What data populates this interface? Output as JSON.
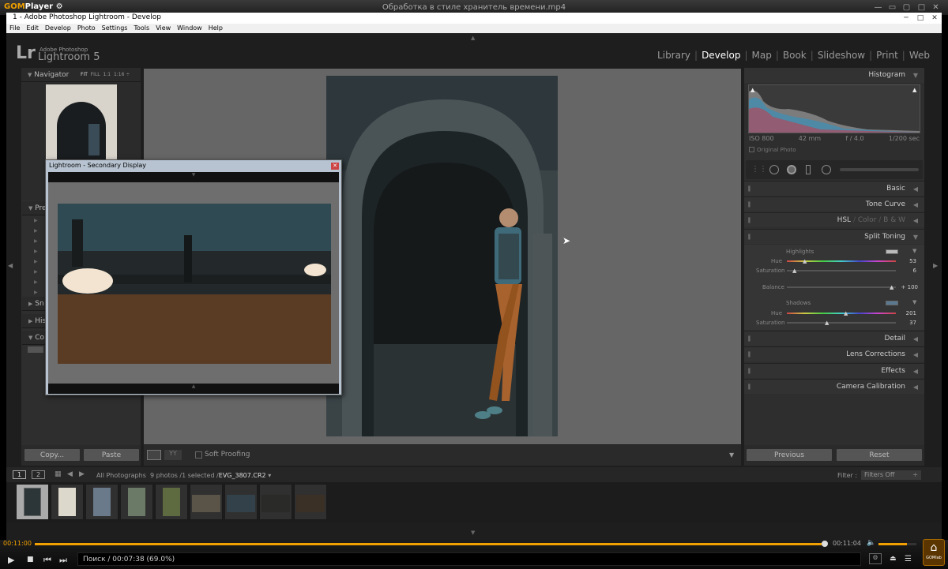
{
  "gom": {
    "logo": "GOM",
    "logo_suffix": "Player",
    "gear_icon": "gear-icon",
    "title": "Обработка в стиле хранитель времени.mp4",
    "time_elapsed": "00:11:00",
    "time_total": "00:11:04",
    "status": "Поиск / 00:07:38 (69.0%)",
    "progress_fraction": 0.994,
    "gomlab_label": "GOMlab",
    "accent_color": "#f0a000"
  },
  "lr_window": {
    "title": "1 - Adobe Photoshop Lightroom - Develop",
    "menu": [
      "File",
      "Edit",
      "Develop",
      "Photo",
      "Settings",
      "Tools",
      "View",
      "Window",
      "Help"
    ]
  },
  "identity": {
    "lr": "Lr",
    "company": "Adobe Photoshop",
    "product": "Lightroom 5"
  },
  "modules": [
    "Library",
    "Develop",
    "Map",
    "Book",
    "Slideshow",
    "Print",
    "Web"
  ],
  "active_module": "Develop",
  "navigator": {
    "title": "Navigator",
    "zoom_options": [
      "FIT",
      "FILL",
      "1:1",
      "1:16 ÷"
    ]
  },
  "left_panels": [
    {
      "label": "Pre"
    },
    {
      "label": "Sn"
    },
    {
      "label": "His"
    },
    {
      "label": "Co"
    }
  ],
  "left_buttons": {
    "copy": "Copy...",
    "paste": "Paste"
  },
  "toolbar": {
    "soft_proofing": "Soft Proofing"
  },
  "histogram": {
    "title": "Histogram",
    "iso": "ISO 800",
    "focal": "42 mm",
    "aperture": "f / 4.0",
    "shutter": "1/200 sec",
    "original_photo": "Original Photo"
  },
  "right_panels": [
    "Basic",
    "Tone Curve"
  ],
  "hsl_tabs": [
    "HSL",
    "Color",
    "B & W"
  ],
  "split_toning": {
    "title": "Split Toning",
    "highlights_label": "Highlights",
    "shadows_label": "Shadows",
    "hue_label": "Hue",
    "saturation_label": "Saturation",
    "balance_label": "Balance",
    "highlights_hue": "53",
    "highlights_saturation": "6",
    "balance": "+ 100",
    "shadows_hue": "201",
    "shadows_saturation": "37"
  },
  "lower_panels": [
    "Detail",
    "Lens Corrections",
    "Effects",
    "Camera Calibration"
  ],
  "right_buttons": {
    "previous": "Previous",
    "reset": "Reset"
  },
  "filmstrip": {
    "page1": "1",
    "page2": "2",
    "source": "All Photographs",
    "count": "9 photos /1 selected /",
    "filename": "EVG_3807.CR2",
    "filter_label": "Filter :",
    "filter_value": "Filters Off",
    "thumb_count": 9
  },
  "secondary": {
    "title": "Lightroom - Secondary Display"
  }
}
